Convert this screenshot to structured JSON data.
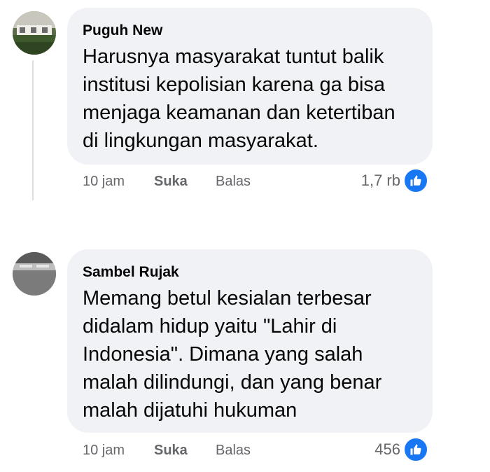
{
  "comments": [
    {
      "author": "Puguh New",
      "text": "Harusnya masyarakat tuntut balik institusi kepolisian karena ga bisa menjaga keamanan dan ketertiban di lingkungan masyarakat.",
      "time": "10 jam",
      "like_label": "Suka",
      "reply_label": "Balas",
      "reaction_count": "1,7 rb",
      "reaction_icon": "thumbs-up-icon"
    },
    {
      "author": "Sambel Rujak",
      "text": "Memang betul kesialan terbesar didalam hidup yaitu \"Lahir di Indonesia\". Dimana yang salah malah dilindungi, dan yang benar malah dijatuhi hukuman",
      "time": "10 jam",
      "like_label": "Suka",
      "reply_label": "Balas",
      "reaction_count": "456",
      "reaction_icon": "thumbs-up-icon"
    }
  ],
  "colors": {
    "bubble": "#f0f2f5",
    "meta_text": "#65676b",
    "like_blue": "#1877f2"
  }
}
